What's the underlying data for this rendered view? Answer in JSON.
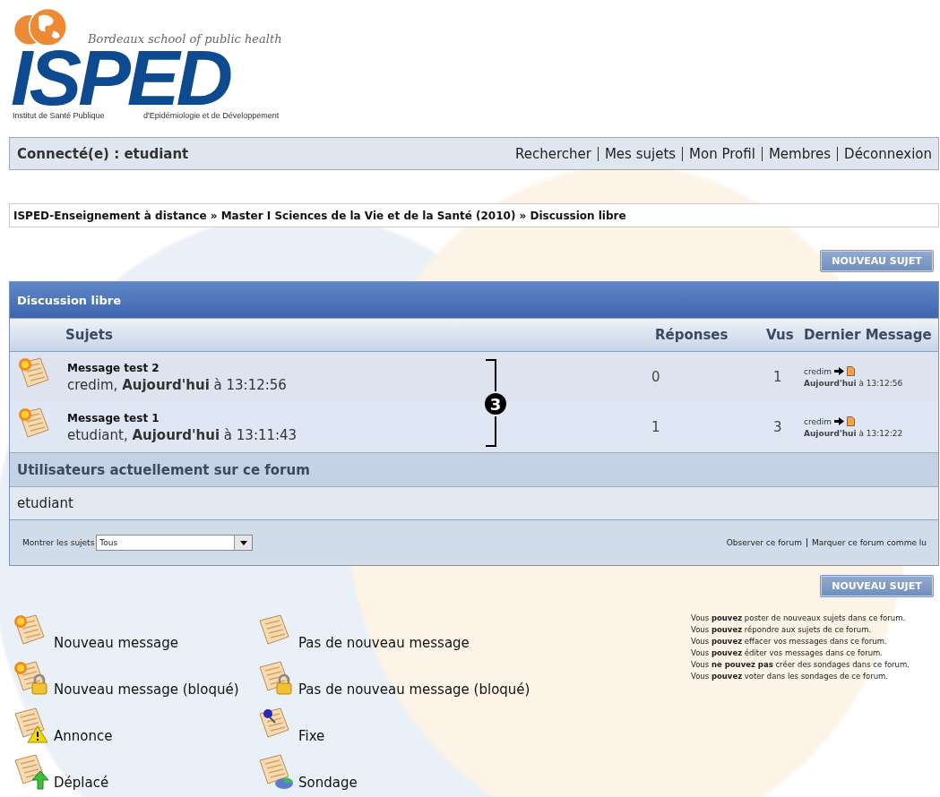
{
  "logo": {
    "tagline": "Bordeaux school of public health",
    "name": "ISPED",
    "left_caption": "Institut de Santé Publique",
    "right_caption": "d'Epidémiologie et de Développement"
  },
  "user_bar": {
    "connected": "Connecté(e) : etudiant",
    "links": [
      "Rechercher",
      "Mes sujets",
      "Mon Profil",
      "Membres",
      "Déconnexion"
    ]
  },
  "breadcrumb": "ISPED-Enseignement à distance » Master I Sciences de la Vie et de la Santé (2010) » Discussion libre",
  "new_topic_top": "NOUVEAU SUJET",
  "forum": {
    "title": "Discussion libre",
    "columns": [
      "Sujets",
      "Réponses",
      "Vus",
      "Dernier Message"
    ],
    "rows": [
      {
        "kind": "new",
        "title": "Message test 2",
        "byline": "credim, **Aujourd'hui** à 13:12:56",
        "replies": "0",
        "views": "1",
        "last_author": "credim",
        "last_date": "**Aujourd'hui** à 13:12:56"
      },
      {
        "kind": "new",
        "title": "Message test 1",
        "byline": "etudiant, **Aujourd'hui** à 13:11:43",
        "replies": "1",
        "views": "3",
        "last_author": "credim",
        "last_date": "**Aujourd'hui** à 13:12:22"
      }
    ],
    "annotation": "3",
    "users_title": "Utilisateurs actuellement sur ce forum",
    "users": "etudiant",
    "filter_label": "Montrer les sujets",
    "filter_value": "Tous",
    "footer_links": [
      "Observer ce forum",
      "Marquer ce forum comme lu"
    ]
  },
  "new_topic_bottom": "NOUVEAU SUJET",
  "legend": [
    {
      "kind": "new",
      "label": "Nouveau message"
    },
    {
      "kind": "none",
      "label": "Pas de nouveau message"
    },
    {
      "kind": "new_locked",
      "label": "Nouveau message (bloqué)"
    },
    {
      "kind": "none_locked",
      "label": "Pas de nouveau message (bloqué)"
    },
    {
      "kind": "announce",
      "label": "Annonce"
    },
    {
      "kind": "sticky",
      "label": "Fixe"
    },
    {
      "kind": "moved",
      "label": "Déplacé"
    },
    {
      "kind": "poll",
      "label": "Sondage"
    }
  ],
  "permissions": [
    "Vous **pouvez** poster de nouveaux sujets dans ce forum.",
    "Vous **pouvez** répondre aux sujets de ce forum.",
    "Vous **pouvez** effacer vos messages dans ce forum.",
    "Vous **pouvez** éditer vos messages dans ce forum.",
    "Vous **ne pouvez pas** créer des sondages dans ce forum.",
    "Vous **pouvez** voter dans les sondages de ce forum."
  ]
}
